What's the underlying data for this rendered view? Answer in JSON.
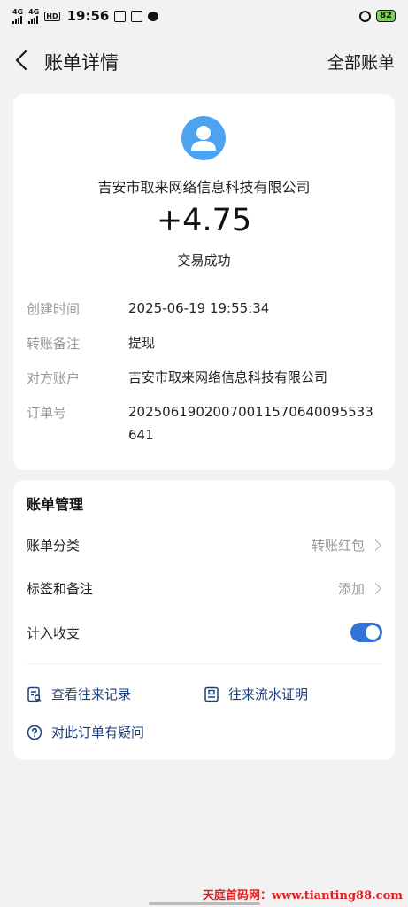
{
  "status_bar": {
    "signal1": "4G",
    "signal2": "4G",
    "hd": "HD",
    "time": "19:56",
    "battery": "82"
  },
  "header": {
    "title": "账单详情",
    "all_bills": "全部账单"
  },
  "transaction": {
    "merchant": "吉安市取来网络信息科技有限公司",
    "amount": "+4.75",
    "status": "交易成功",
    "details": [
      {
        "label": "创建时间",
        "value": "2025-06-19 19:55:34"
      },
      {
        "label": "转账备注",
        "value": "提现"
      },
      {
        "label": "对方账户",
        "value": "吉安市取来网络信息科技有限公司"
      },
      {
        "label": "订单号",
        "value": "20250619020070011570640095533641"
      }
    ]
  },
  "management": {
    "title": "账单管理",
    "category_label": "账单分类",
    "category_value": "转账红包",
    "tags_label": "标签和备注",
    "tags_value": "添加",
    "income_label": "计入收支",
    "income_on": true,
    "view_records": "查看往来记录",
    "flow_proof": "往来流水证明",
    "question": "对此订单有疑问"
  },
  "watermark": "天庭首码网：www.tianting88.com",
  "colors": {
    "accent": "#2f74d6",
    "link": "#1b3f7a",
    "avatar": "#4da3f0"
  }
}
